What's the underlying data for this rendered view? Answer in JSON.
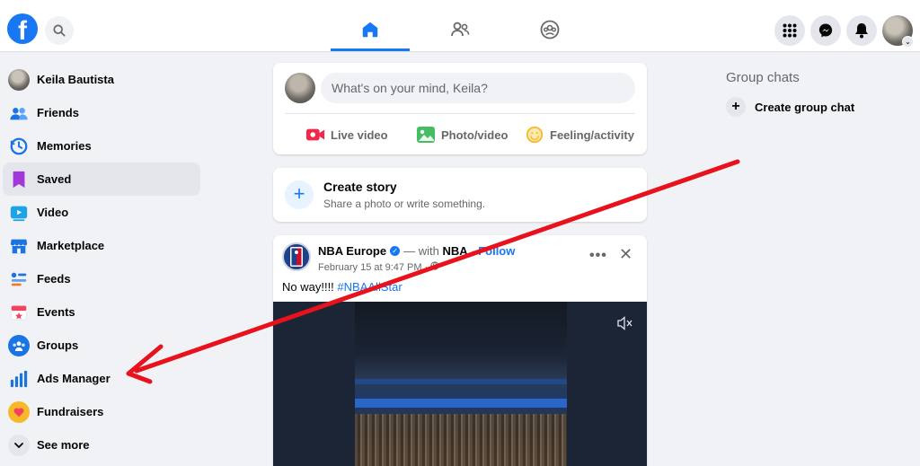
{
  "header": {
    "logo_letter": "f",
    "tabs": [
      "home",
      "friends",
      "groups"
    ],
    "active_tab": "home",
    "colors": {
      "brand": "#1877f2"
    }
  },
  "sidebar": {
    "items": [
      {
        "label": "Keila Bautista",
        "icon": "avatar"
      },
      {
        "label": "Friends",
        "icon": "friends-icon"
      },
      {
        "label": "Memories",
        "icon": "memories-clock-icon"
      },
      {
        "label": "Saved",
        "icon": "saved-bookmark-icon",
        "highlighted": true
      },
      {
        "label": "Video",
        "icon": "video-icon"
      },
      {
        "label": "Marketplace",
        "icon": "marketplace-shop-icon"
      },
      {
        "label": "Feeds",
        "icon": "feeds-icon"
      },
      {
        "label": "Events",
        "icon": "events-calendar-icon"
      },
      {
        "label": "Groups",
        "icon": "groups-icon"
      },
      {
        "label": "Ads Manager",
        "icon": "ads-manager-chart-icon"
      },
      {
        "label": "Fundraisers",
        "icon": "fundraisers-heart-icon"
      },
      {
        "label": "See more",
        "icon": "chevron-down-icon"
      }
    ]
  },
  "composer": {
    "placeholder": "What's on your mind, Keila?",
    "actions": [
      {
        "label": "Live video",
        "icon": "live-video-icon",
        "color": "#f02849"
      },
      {
        "label": "Photo/video",
        "icon": "photo-icon",
        "color": "#45bd62"
      },
      {
        "label": "Feeling/activity",
        "icon": "feeling-smiley-icon",
        "color": "#f7b928"
      }
    ]
  },
  "story": {
    "title": "Create story",
    "subtitle": "Share a photo or write something."
  },
  "post": {
    "author": "NBA Europe",
    "with_text": "— with",
    "with_name": "NBA",
    "separator": "·",
    "follow": "Follow",
    "date": "February 15 at 9:47 PM",
    "meta_sep": "·",
    "text": "No way!!!!",
    "hashtag": "#NBAAllStar"
  },
  "right_rail": {
    "title": "Group chats",
    "create_label": "Create group chat"
  },
  "annotation": {
    "color": "#e8121d",
    "points_to": "Ads Manager"
  }
}
